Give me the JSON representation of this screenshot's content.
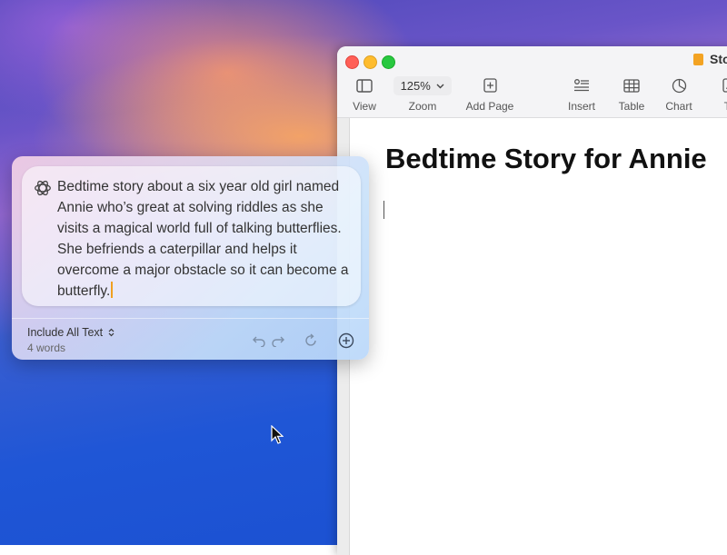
{
  "window": {
    "title": "Sto",
    "toolbar": [
      {
        "id": "view",
        "label": "View",
        "icon": "sidebar-icon"
      },
      {
        "id": "zoom",
        "label": "Zoom",
        "value": "125%",
        "icon": "chevron-down-icon"
      },
      {
        "id": "add_page",
        "label": "Add Page",
        "icon": "add-page-icon"
      },
      {
        "id": "insert",
        "label": "Insert",
        "icon": "insert-icon"
      },
      {
        "id": "table",
        "label": "Table",
        "icon": "table-icon"
      },
      {
        "id": "chart",
        "label": "Chart",
        "icon": "chart-icon"
      },
      {
        "id": "text",
        "label": "Te",
        "icon": "text-icon"
      }
    ]
  },
  "document": {
    "heading": "Bedtime Story for Annie"
  },
  "writing_tools": {
    "prompt": "Bedtime story about a six year old girl named Annie who’s great at solving riddles as she visits a magical world full of talking butterflies. She befriends a caterpillar and helps it overcome a major obstacle so it can become a butterfly.",
    "include_label": "Include All Text",
    "word_count": "4 words"
  },
  "colors": {
    "close": "#ff5f57",
    "minimize": "#febc2e",
    "maximize": "#28c840",
    "caret": "#f0a020"
  }
}
